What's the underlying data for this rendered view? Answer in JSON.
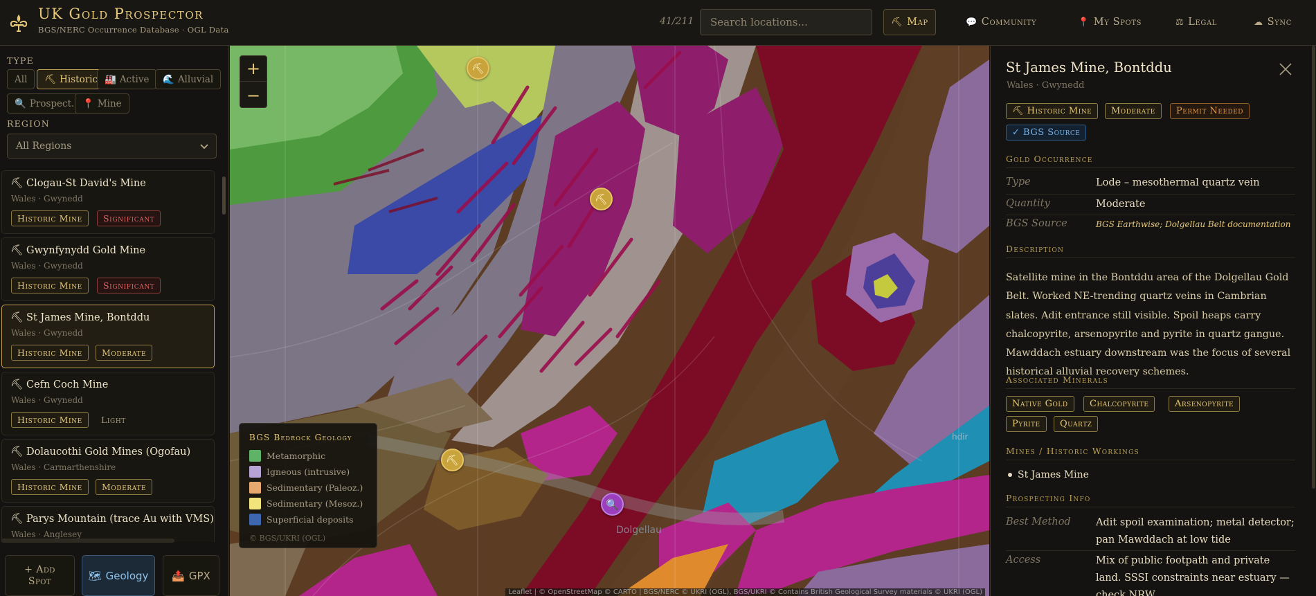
{
  "header": {
    "title": "UK Gold Prospector",
    "subtitle": "BGS/NERC Occurrence Database · OGL Data",
    "count": "41/211",
    "search_placeholder": "Search locations...",
    "nav": {
      "map": "Map",
      "community": "Community",
      "my_spots": "My Spots",
      "legal": "Legal",
      "sync": "Sync"
    }
  },
  "sidebar": {
    "type_label": "TYPE",
    "type_chips": {
      "all": "All",
      "historic": "Historic",
      "active": "Active",
      "alluvial": "Alluvial",
      "prospect": "Prospect.",
      "mine": "Mine"
    },
    "region_label": "REGION",
    "region_value": "All Regions",
    "items": [
      {
        "name": "Clogau-St David's Mine",
        "location": "Wales · Gwynedd",
        "type": "Historic Mine",
        "grade": "Significant"
      },
      {
        "name": "Gwynfynydd Gold Mine",
        "location": "Wales · Gwynedd",
        "type": "Historic Mine",
        "grade": "Significant"
      },
      {
        "name": "St James Mine, Bontddu",
        "location": "Wales · Gwynedd",
        "type": "Historic Mine",
        "grade": "Moderate"
      },
      {
        "name": "Cefn Coch Mine",
        "location": "Wales · Gwynedd",
        "type": "Historic Mine",
        "grade": "Light"
      },
      {
        "name": "Dolaucothi Gold Mines (Ogofau)",
        "location": "Wales · Carmarthenshire",
        "type": "Historic Mine",
        "grade": "Moderate"
      },
      {
        "name": "Parys Mountain (trace Au with VMS)",
        "location": "Wales · Anglesey"
      }
    ],
    "buttons": {
      "add_spot": "+ Add Spot",
      "geology": "Geology",
      "gpx": "GPX"
    }
  },
  "map": {
    "legend": {
      "title": "BGS Bedrock Geology",
      "items": [
        {
          "label": "Metamorphic",
          "color": "#5fb366"
        },
        {
          "label": "Igneous (intrusive)",
          "color": "#b8a4d4"
        },
        {
          "label": "Sedimentary (Paleoz.)",
          "color": "#e8a970"
        },
        {
          "label": "Sedimentary (Mesoz.)",
          "color": "#f1e47a"
        },
        {
          "label": "Superficial deposits",
          "color": "#3d68b0"
        }
      ],
      "credit": "© BGS/UKRI (OGL)"
    },
    "place_label": "Dolgellau",
    "place_label_2": "hdir",
    "attribution": "Leaflet | © OpenStreetMap © CARTO | BGS/NERC © UKRI (OGL), BGS/UKRI © Contains British Geological Survey materials © UKRI (OGL)"
  },
  "detail": {
    "title": "St James Mine, Bontddu",
    "location": "Wales · Gwynedd",
    "badges": {
      "type": "Historic Mine",
      "grade": "Moderate",
      "permit": "Permit Needed",
      "source": "BGS Source"
    },
    "gold_occurrence": {
      "heading": "Gold Occurrence",
      "type_label": "Type",
      "type_value": "Lode – mesothermal quartz vein",
      "quantity_label": "Quantity",
      "quantity_value": "Moderate",
      "source_label": "BGS Source",
      "source_value": "BGS Earthwise; Dolgellau Belt documentation"
    },
    "description_heading": "Description",
    "description": "Satellite mine in the Bontddu area of the Dolgellau Gold Belt. Worked NE-trending quartz veins in Cambrian slates. Adit entrance still visible. Spoil heaps carry chalcopyrite, arsenopyrite and pyrite in quartz gangue. Mawddach estuary downstream was the focus of several historical alluvial recovery schemes.",
    "minerals_heading": "Associated Minerals",
    "minerals": [
      "Native Gold",
      "Chalcopyrite",
      "Arsenopyrite",
      "Pyrite",
      "Quartz"
    ],
    "workings_heading": "Mines / Historic Workings",
    "workings": [
      "St James Mine"
    ],
    "prospecting_heading": "Prospecting Info",
    "best_method_label": "Best Method",
    "best_method_value": "Adit spoil examination; metal detector; pan Mawddach at low tide",
    "access_label": "Access",
    "access_value": "Mix of public footpath and private land. SSSI constraints near estuary — check NRW."
  }
}
